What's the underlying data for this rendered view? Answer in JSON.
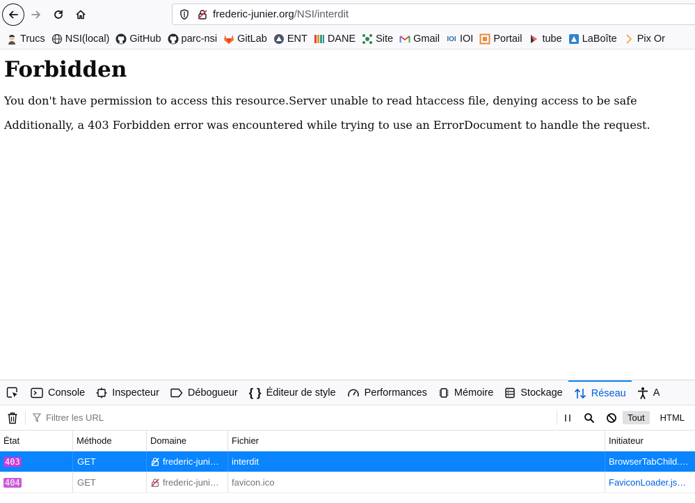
{
  "browser": {
    "url_host": "frederic-junier.org",
    "url_path": "/NSI/interdit"
  },
  "bookmarks": [
    {
      "label": "Trucs",
      "icon": "avatar-icon"
    },
    {
      "label": "NSI(local)",
      "icon": "globe-icon"
    },
    {
      "label": "GitHub",
      "icon": "github-icon"
    },
    {
      "label": "parc-nsi",
      "icon": "github-icon"
    },
    {
      "label": "GitLab",
      "icon": "gitlab-icon"
    },
    {
      "label": "ENT",
      "icon": "ent-icon"
    },
    {
      "label": "DANE",
      "icon": "dane-icon"
    },
    {
      "label": "Site",
      "icon": "site-icon"
    },
    {
      "label": "Gmail",
      "icon": "gmail-icon"
    },
    {
      "label": "IOI",
      "icon": "ioi-icon"
    },
    {
      "label": "Portail",
      "icon": "portail-icon"
    },
    {
      "label": "tube",
      "icon": "tube-icon"
    },
    {
      "label": "LaBoîte",
      "icon": "laboite-icon"
    },
    {
      "label": "Pix Or",
      "icon": "pix-icon"
    }
  ],
  "page": {
    "heading": "Forbidden",
    "p1": "You don't have permission to access this resource.Server unable to read htaccess file, denying access to be safe",
    "p2": "Additionally, a 403 Forbidden error was encountered while trying to use an ErrorDocument to handle the request."
  },
  "devtools": {
    "tabs": [
      {
        "label": "Console",
        "icon": "console-icon"
      },
      {
        "label": "Inspecteur",
        "icon": "inspector-icon"
      },
      {
        "label": "Débogueur",
        "icon": "debugger-icon"
      },
      {
        "label": "Éditeur de style",
        "icon": "style-editor-icon"
      },
      {
        "label": "Performances",
        "icon": "performance-icon"
      },
      {
        "label": "Mémoire",
        "icon": "memory-icon"
      },
      {
        "label": "Stockage",
        "icon": "storage-icon"
      },
      {
        "label": "Réseau",
        "icon": "network-icon",
        "active": true
      },
      {
        "label": "A",
        "icon": "accessibility-icon"
      }
    ],
    "filter_placeholder": "Filtrer les URL",
    "type_all": "Tout",
    "type_html": "HTML",
    "columns": {
      "state": "État",
      "method": "Méthode",
      "domain": "Domaine",
      "file": "Fichier",
      "initiator": "Initiateur"
    },
    "rows": [
      {
        "status": "403",
        "method": "GET",
        "domain": "frederic-juni…",
        "file": "interdit",
        "initiator": "BrowserTabChild.…",
        "selected": true,
        "status_color": "#c73ad9"
      },
      {
        "status": "404",
        "method": "GET",
        "domain": "frederic-juni…",
        "file": "favicon.ico",
        "initiator": "FaviconLoader.js…",
        "selected": false,
        "status_color": "#c95bd6"
      }
    ]
  }
}
